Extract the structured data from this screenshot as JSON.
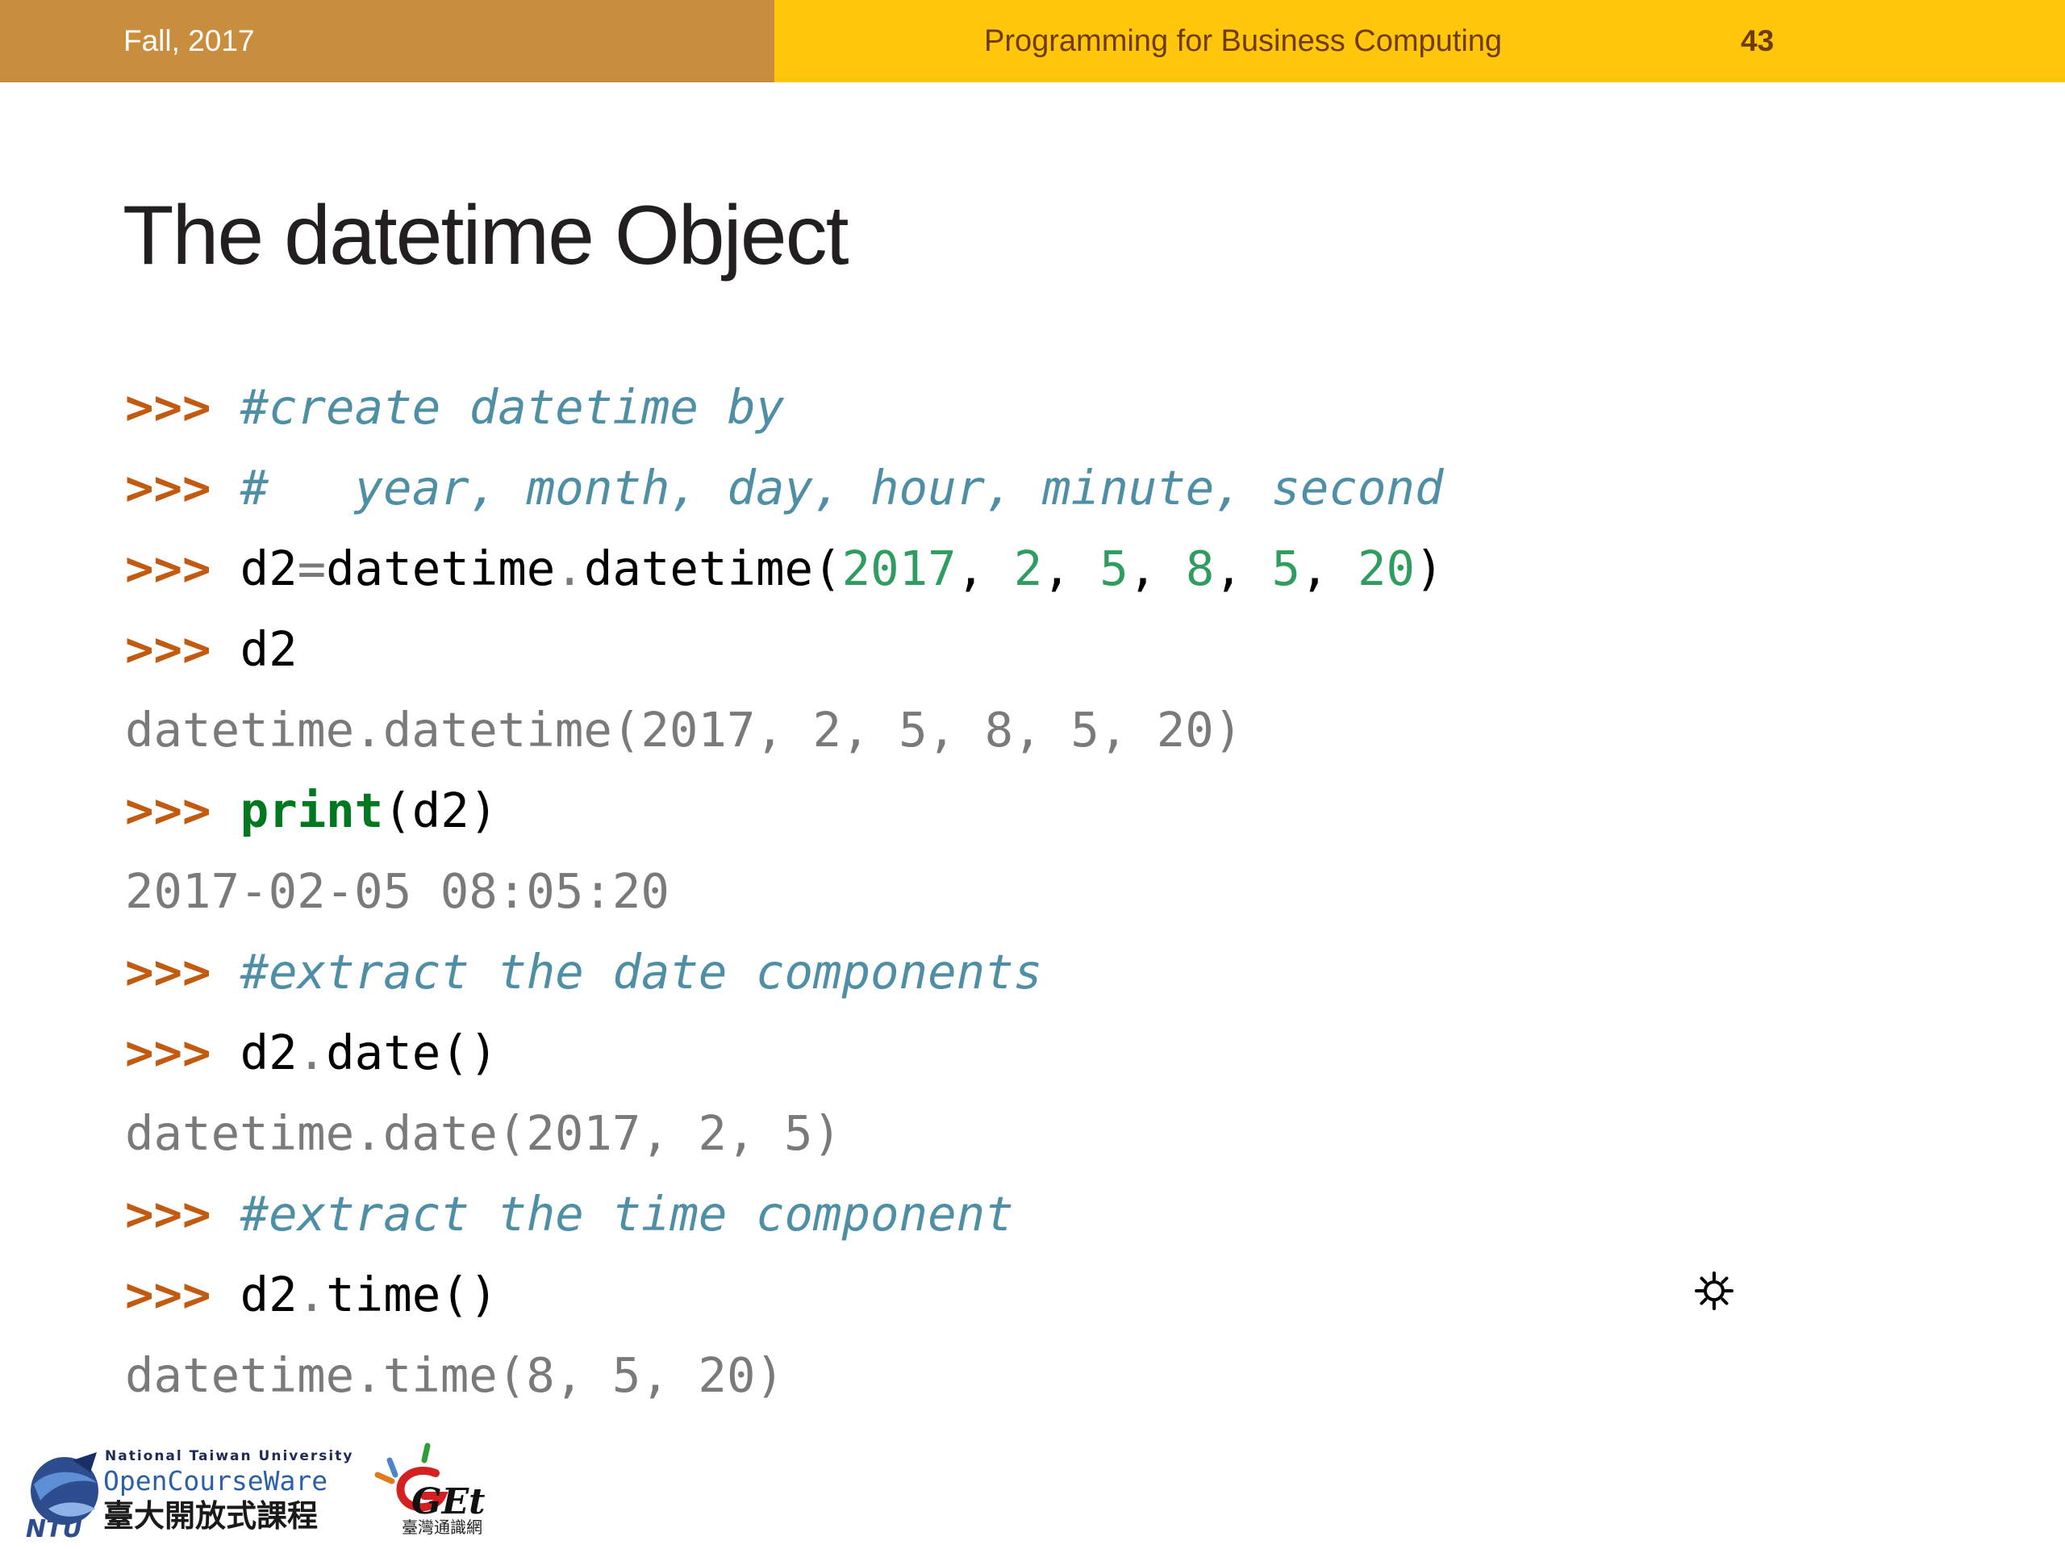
{
  "header": {
    "term": "Fall, 2017",
    "course": "Programming for Business Computing",
    "page_number": "43"
  },
  "slide": {
    "title": "The datetime Object"
  },
  "code": {
    "prompt": ">>>",
    "l1": {
      "comment": "#create datetime by"
    },
    "l2": {
      "comment": "#   year, month, day, hour, minute, second"
    },
    "l3": {
      "target": "d2",
      "eq": "=",
      "obj": "datetime",
      "dot": ".",
      "func": "datetime",
      "open": "(",
      "a1": "2017",
      "sep": ", ",
      "a2": "2",
      "a3": "5",
      "a4": "8",
      "a5": "5",
      "a6": "20",
      "close": ")"
    },
    "l4": {
      "text": "d2"
    },
    "l5": {
      "output": "datetime.datetime(2017, 2, 5, 8, 5, 20)"
    },
    "l6": {
      "kw": "print",
      "args": "(d2)"
    },
    "l7": {
      "output": "2017-02-05 08:05:20"
    },
    "l8": {
      "comment": "#extract the date components"
    },
    "l9": {
      "obj": "d2",
      "dot": ".",
      "call": "date()"
    },
    "l10": {
      "output": "datetime.date(2017, 2, 5)"
    },
    "l11": {
      "comment": "#extract the time component"
    },
    "l12": {
      "obj": "d2",
      "dot": ".",
      "call": "time()"
    },
    "l13": {
      "output": "datetime.time(8, 5, 20)"
    }
  },
  "footer": {
    "ntu_line1": "National Taiwan University",
    "ntu_line2": "OpenCourseWare",
    "ntu_line3": "臺大開放式課程",
    "ntu_mark": "NTU",
    "get_logo": "GEt",
    "get_caption": "臺灣通識網"
  },
  "colors": {
    "header_left": "#C98D3E",
    "header_right": "#FFC60B",
    "prompt": "#C25A0F",
    "comment": "#4E8FA5",
    "number": "#2E9D5F",
    "keyword": "#007820",
    "output": "#7A7A7A"
  },
  "icons": {
    "cursor": "sun-gear-icon"
  }
}
